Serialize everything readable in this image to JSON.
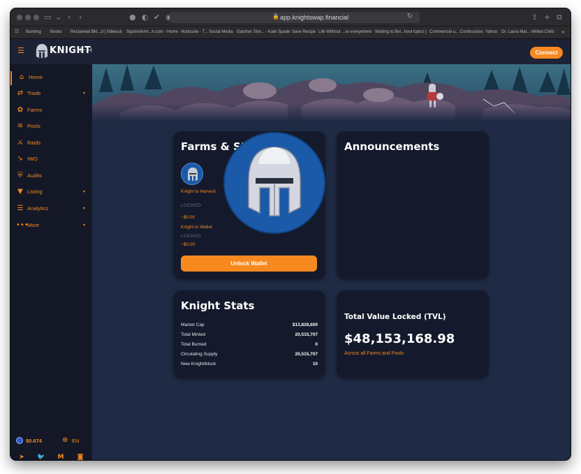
{
  "browser": {
    "url": "app.knightswap.financial",
    "bookmarks": [
      "Banking",
      "Books",
      "Reclaimed Bkt...d | Stikeout",
      "SquirrelAmr...h.com - Home",
      "Hootsuite - T... Social Media",
      "Gardner Stre... - Kate Spade",
      "Save Recipe",
      "Life Without ...re everywhere",
      "Waiting to Bel...hool topics |",
      "Commercial u... Confessions",
      "Yahoo",
      "Dr. Laura Mar...-Willed Child"
    ]
  },
  "header": {
    "logo_text": "KNIGHT",
    "connect_label": "Connect"
  },
  "sidebar": {
    "items": [
      {
        "label": "Home",
        "icon": "home-icon",
        "glyph": "⌂",
        "caret": false,
        "active": true
      },
      {
        "label": "Trade",
        "icon": "trade-icon",
        "glyph": "⇄",
        "caret": true
      },
      {
        "label": "Farms",
        "icon": "farms-icon",
        "glyph": "✿",
        "caret": false
      },
      {
        "label": "Pools",
        "icon": "pools-icon",
        "glyph": "≋",
        "caret": false
      },
      {
        "label": "Raids",
        "icon": "raids-icon",
        "glyph": "⚔",
        "caret": false
      },
      {
        "label": "IWO",
        "icon": "iwo-icon",
        "glyph": "➘",
        "caret": false
      },
      {
        "label": "Audits",
        "icon": "audits-icon",
        "glyph": "⛨",
        "caret": false
      },
      {
        "label": "Listing",
        "icon": "listing-icon",
        "glyph": "▼",
        "caret": true
      },
      {
        "label": "Analytics",
        "icon": "analytics-icon",
        "glyph": "☰",
        "caret": true
      },
      {
        "label": "More",
        "icon": "more-icon",
        "glyph": "•••",
        "caret": true
      }
    ],
    "price": "$0.674",
    "language": "EN",
    "socials": [
      {
        "name": "telegram-icon",
        "glyph": "➤"
      },
      {
        "name": "twitter-icon",
        "glyph": "🐦"
      },
      {
        "name": "medium-icon",
        "glyph": "M"
      },
      {
        "name": "discord-icon",
        "glyph": "◙"
      }
    ]
  },
  "farms": {
    "title": "Farms & Staking",
    "harvest_label": "Knight to Harvest",
    "harvest_status": "LOCKED",
    "harvest_value": "~$0.00",
    "wallet_label": "Knight in Wallet",
    "wallet_status": "LOCKED",
    "wallet_value": "~$0.00",
    "unlock_label": "Unlock Wallet"
  },
  "announcements": {
    "title": "Announcements"
  },
  "stats": {
    "title": "Knight Stats",
    "rows": [
      {
        "label": "Market Cap",
        "value": "$13,828,600"
      },
      {
        "label": "Total Minted",
        "value": "20,515,707"
      },
      {
        "label": "Total Burned",
        "value": "0"
      },
      {
        "label": "Circulating Supply",
        "value": "20,515,707"
      },
      {
        "label": "New Knight/block",
        "value": "10"
      }
    ]
  },
  "tvl": {
    "title": "Total Value Locked (TVL)",
    "value": "$48,153,168.98",
    "subtitle": "Across all Farms and Pools"
  },
  "colors": {
    "accent": "#f6891f",
    "background": "#1f2a44",
    "card": "#141a2b",
    "sidebar": "#141826",
    "helmet_blue": "#1b5aa8"
  }
}
